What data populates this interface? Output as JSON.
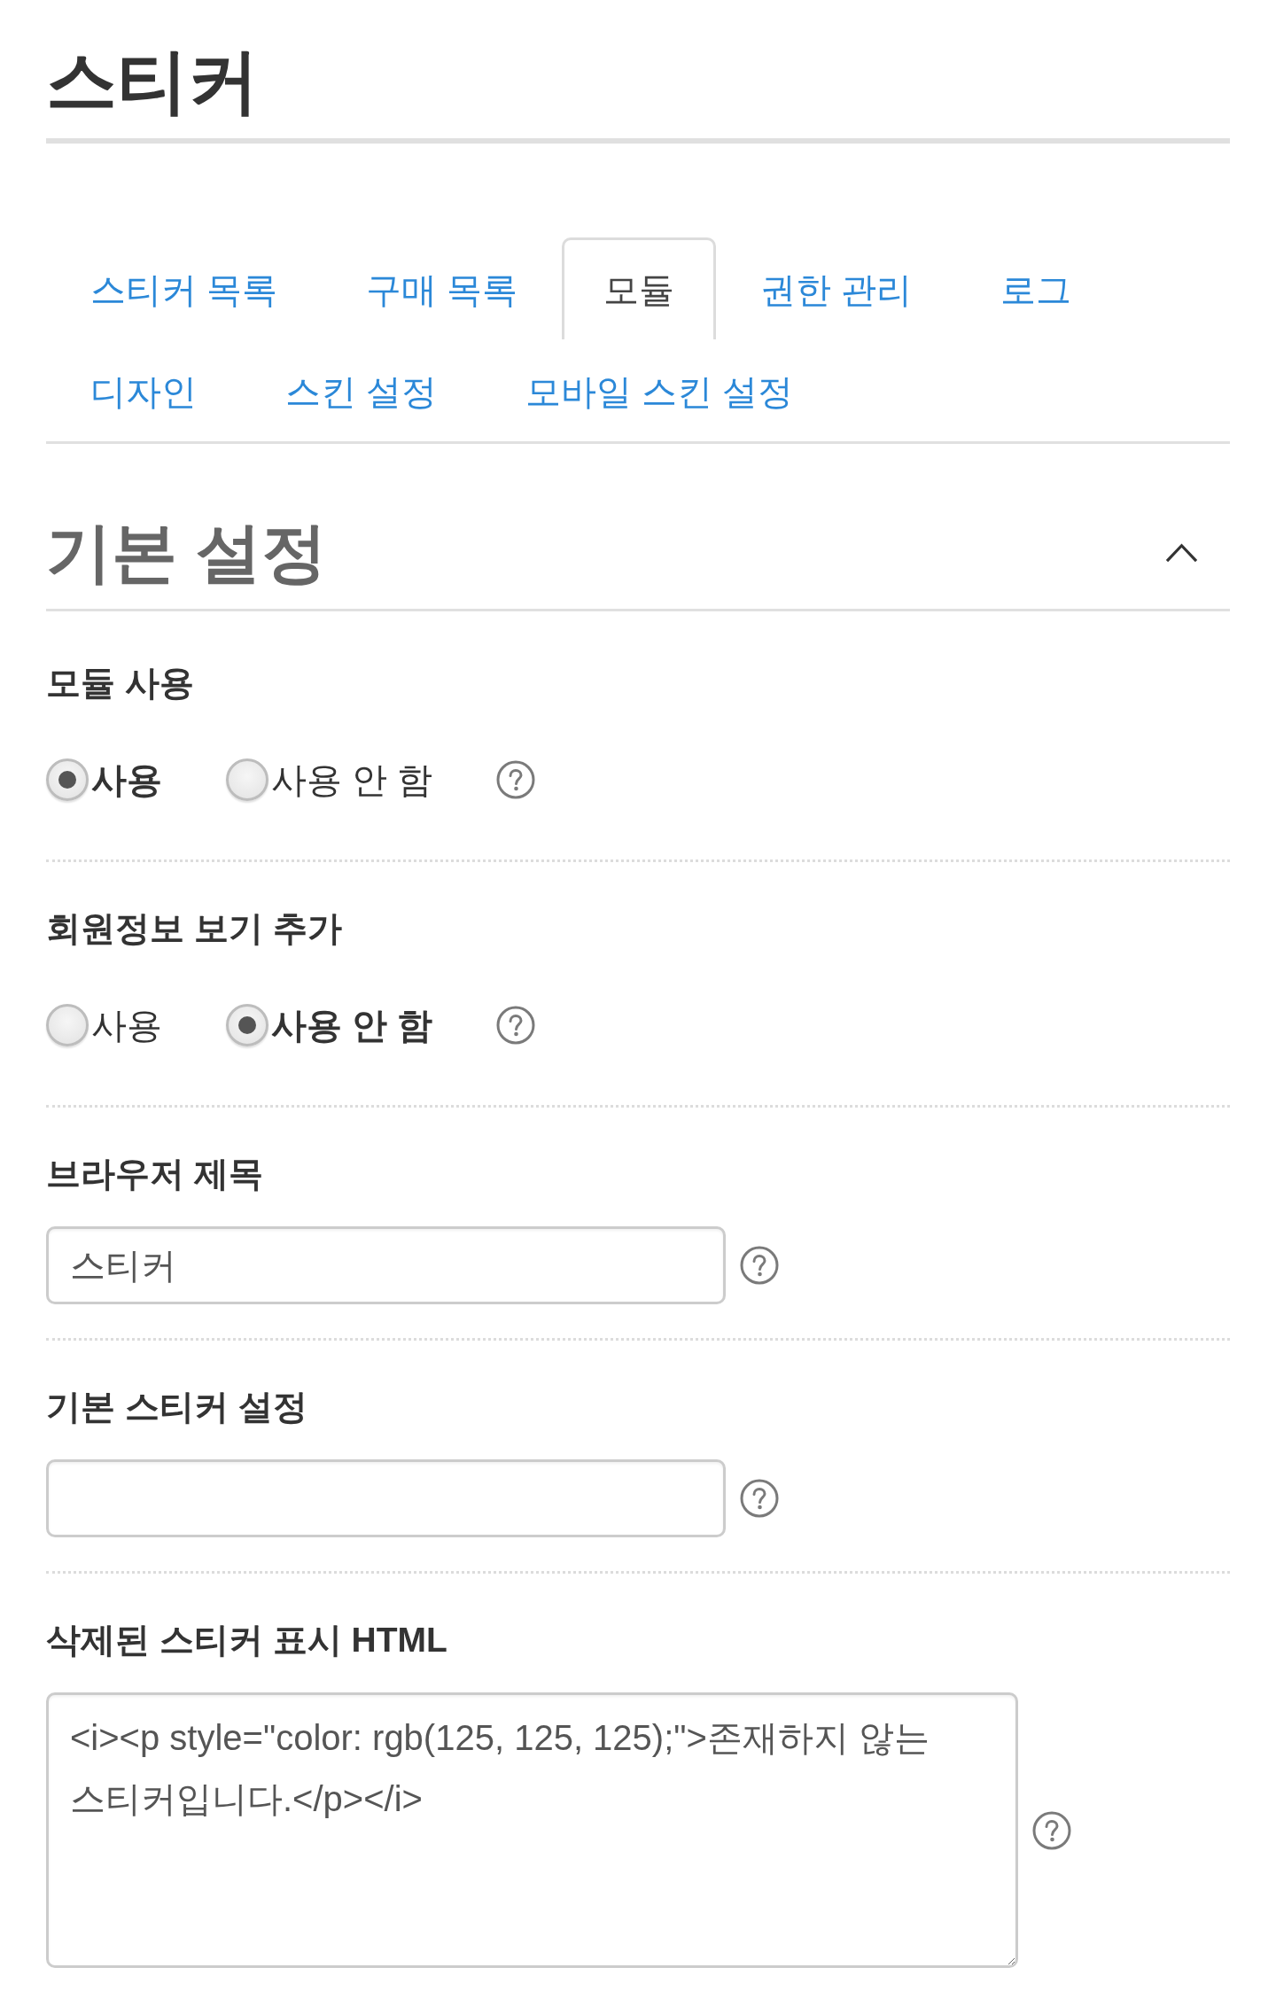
{
  "page": {
    "title": "스티커"
  },
  "tabs": [
    {
      "label": "스티커 목록",
      "selected": false
    },
    {
      "label": "구매 목록",
      "selected": false
    },
    {
      "label": "모듈",
      "selected": true
    },
    {
      "label": "권한 관리",
      "selected": false
    },
    {
      "label": "로그",
      "selected": false
    },
    {
      "label": "디자인",
      "selected": false
    },
    {
      "label": "스킨 설정",
      "selected": false
    },
    {
      "label": "모바일 스킨 설정",
      "selected": false
    }
  ],
  "section": {
    "title": "기본 설정",
    "expanded": true,
    "fields": [
      {
        "kind": "radio",
        "label": "모듈 사용",
        "options": [
          {
            "label": "사용",
            "selected": true
          },
          {
            "label": "사용 안 함",
            "selected": false
          }
        ],
        "help": true
      },
      {
        "kind": "radio",
        "label": "회원정보 보기 추가",
        "options": [
          {
            "label": "사용",
            "selected": false
          },
          {
            "label": "사용 안 함",
            "selected": true
          }
        ],
        "help": true
      },
      {
        "kind": "text",
        "label": "브라우저 제목",
        "value": "스티커",
        "help": true
      },
      {
        "kind": "text",
        "label": "기본 스티커 설정",
        "help": true
      },
      {
        "kind": "textarea",
        "label": "삭제된 스티커 표시 HTML",
        "value": "<i><p style=\"color: rgb(125, 125, 125);\">존재하지 않는 스티커입니다.</p></i>",
        "help": true
      }
    ]
  }
}
